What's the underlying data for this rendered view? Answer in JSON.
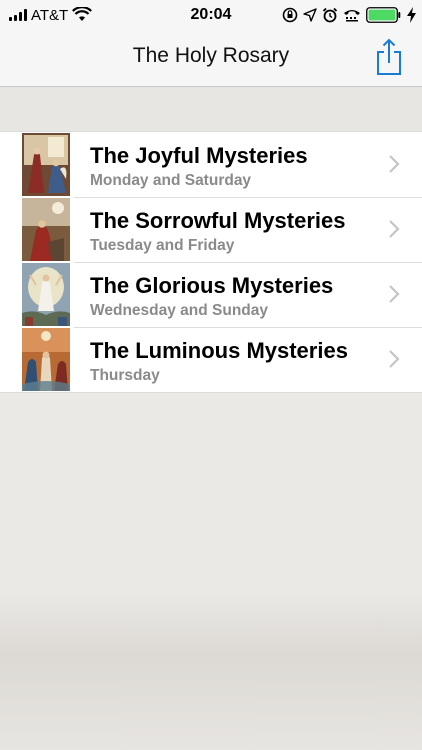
{
  "status_bar": {
    "carrier": "AT&T",
    "time": "20:04",
    "battery_color": "#4cd964"
  },
  "nav": {
    "title": "The Holy Rosary",
    "share_icon": "share-icon",
    "accent": "#1a7bd6"
  },
  "mysteries": [
    {
      "title": "The Joyful Mysteries",
      "days": "Monday and Saturday",
      "icon": "painting-annunciation"
    },
    {
      "title": "The Sorrowful Mysteries",
      "days": "Tuesday and Friday",
      "icon": "painting-agony-garden"
    },
    {
      "title": "The Glorious Mysteries",
      "days": "Wednesday and Sunday",
      "icon": "painting-resurrection"
    },
    {
      "title": "The Luminous Mysteries",
      "days": "Thursday",
      "icon": "painting-baptism"
    }
  ]
}
